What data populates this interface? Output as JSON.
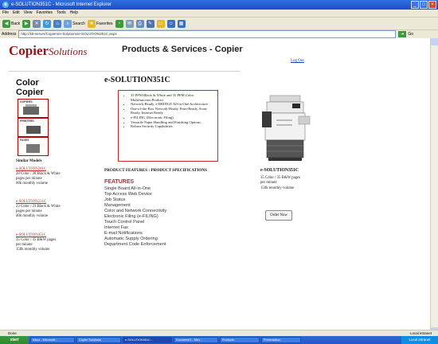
{
  "window": {
    "title": "e-SOLUTION351C - Microsoft Internet Explorer"
  },
  "menu": [
    "File",
    "Edit",
    "View",
    "Favorites",
    "Tools",
    "Help"
  ],
  "toolbar": {
    "back": "Back",
    "search": "Search",
    "favorites": "Favorites"
  },
  "address": {
    "label": "Address",
    "url": "http://k8-server/Copiers/e-Solutions/e-SOLUTION351C.aspx",
    "go": "Go"
  },
  "page": {
    "logo_main": "Copier",
    "logo_sub": "Solutions",
    "heading": "Products & Services - Copier",
    "logout": "Log Out",
    "sidebar_title_1": "Color",
    "sidebar_title_2": "Copier",
    "thumbs": [
      "COPIERS",
      "PRINTERS",
      "FAXES"
    ],
    "similar_label": "Similar Models",
    "similar_models": [
      {
        "name": "e-SOLUTION281C",
        "line1": "28 Color / 28 Black & White",
        "line2": "pages per minute",
        "line3": "60k monthly volume"
      },
      {
        "name": "e-SOLUTION231C",
        "line1": "23 Color / 23 Black & White",
        "line2": "pages per minute",
        "line3": "40k monthly volume"
      },
      {
        "name": "e-SOLUTION451C",
        "line1": "35 Color / 35 B&W pages",
        "line2": "per minute",
        "line3": "150k monthly volume"
      }
    ],
    "product_title": "e-SOLUTION351C",
    "features_box": [
      "35 PPM Black & White and 35 PPM Color Multifunction Product",
      "Network-Ready, e-BRIDGE All-in-One Architecture",
      "One-of-the-Box Network-Ready, Print-Ready, Scan-Ready, Internet Ready",
      "e-FILING (Electronic Filing)",
      "Versatile Paper Handling and Finishing Options",
      "Robust Security Capabilities"
    ],
    "tabs_text": "PRODUCT FEATURES : PRODUCT SPECIFICATIONS",
    "features_heading": "FEATURES",
    "features_list": [
      "Single Board All-in-One",
      "Top Access Web Device",
      "Job Status",
      "Management",
      "Color and Network Connectivity",
      "Electronic Filing (e-FILING)",
      "Touch Control Panel",
      "Internet Fax",
      "E-mail Notifications",
      "Automatic Supply Ordering",
      "Department Code Enforcement"
    ],
    "right_title": "e-SOLUTION351C",
    "right_desc_1": "35 Color / 35 B&W pages",
    "right_desc_2": "per minute",
    "right_desc_3": "150k monthly volume",
    "order_label": "Order Now"
  },
  "status": {
    "left": "Done",
    "zone": "Local intranet"
  },
  "taskbar": {
    "start": "start",
    "tasks": [
      "Inbox - Microsoft...",
      "Copier Solutions",
      "e-SOLUTION351C...",
      "Document1 - Micr...",
      "Products",
      "Presentation"
    ],
    "clock": "Local intranet"
  },
  "colors": {
    "brand": "#8a1a1a",
    "accent_red": "#c8282c",
    "link_blue": "#1a3cc7"
  }
}
